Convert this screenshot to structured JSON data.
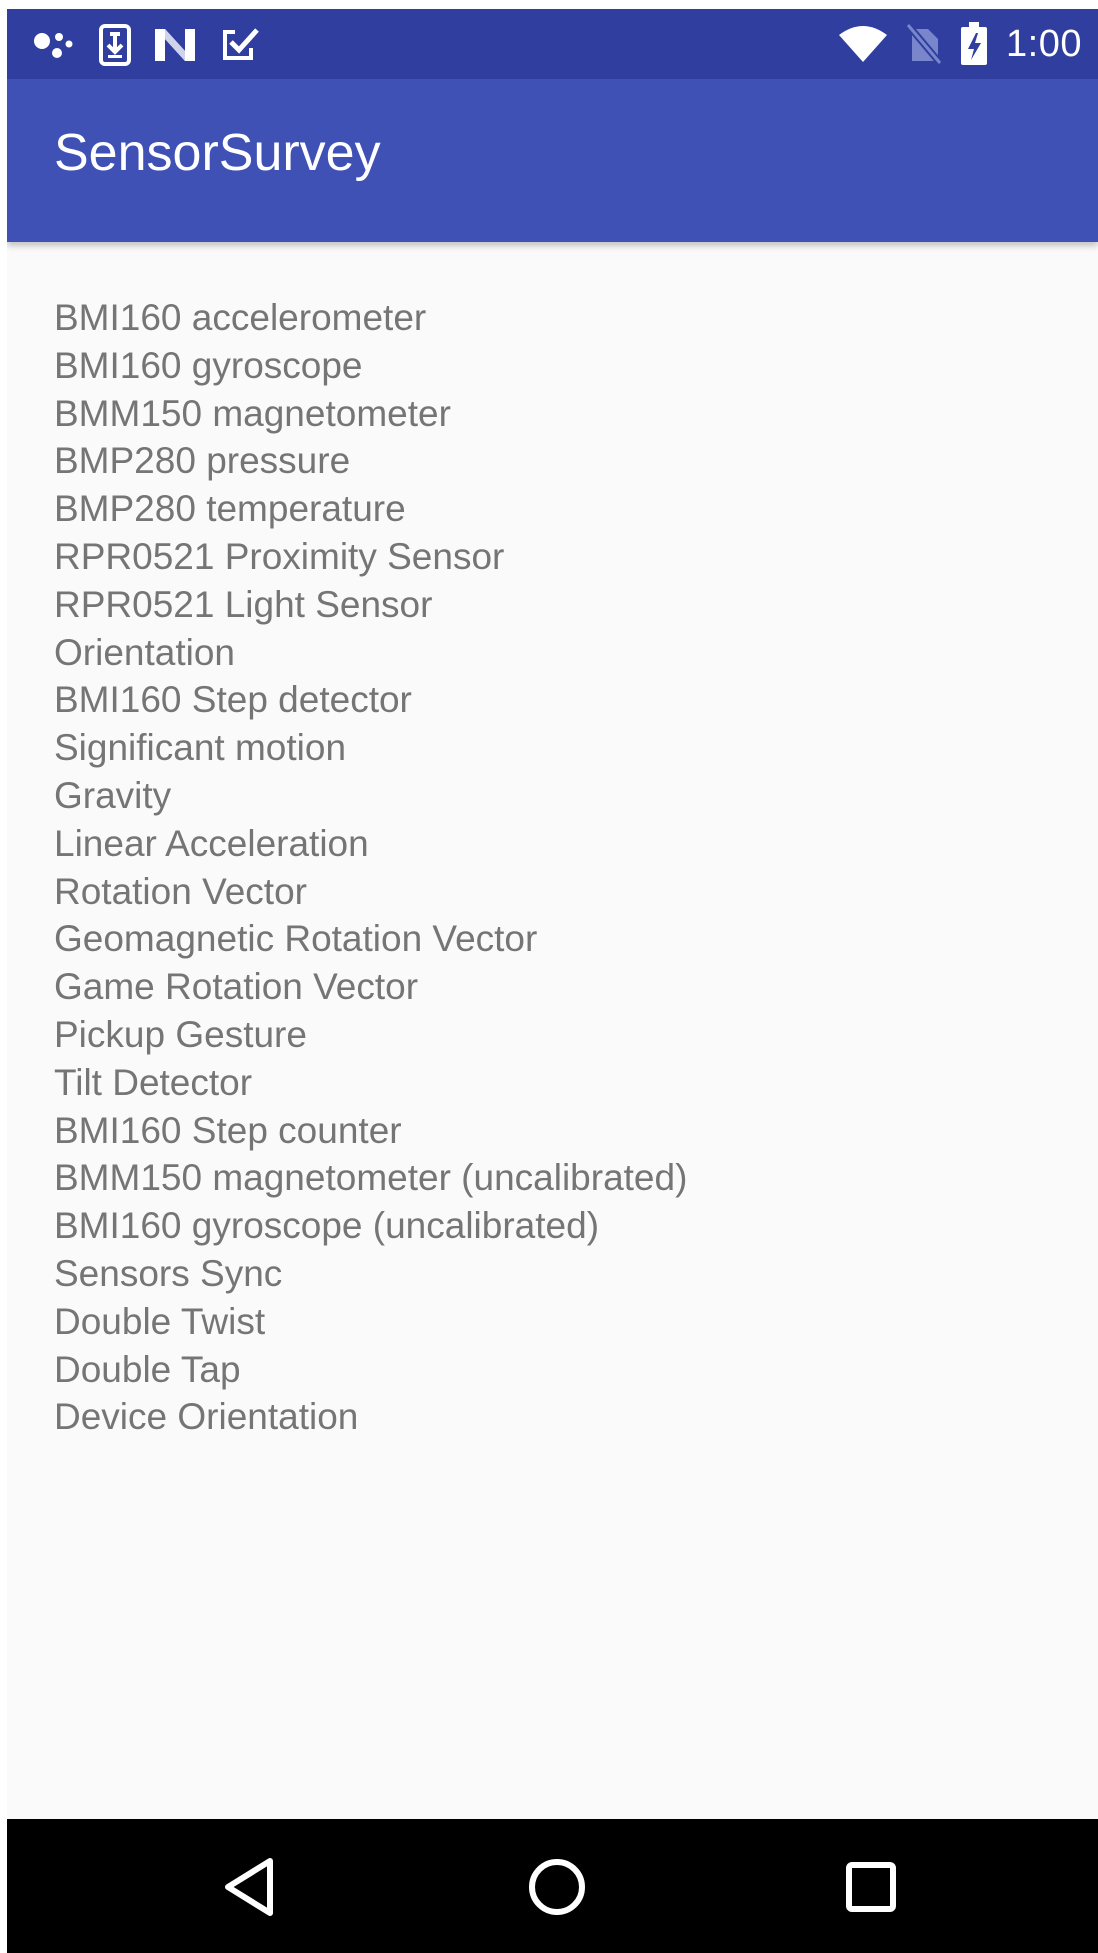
{
  "status_bar": {
    "time": "1:00",
    "left_icons": [
      "assistant-dots-icon",
      "download-icon",
      "n-logo-icon",
      "checkbox-check-icon"
    ],
    "right_icons": [
      "wifi-icon",
      "no-sim-icon",
      "battery-charging-icon"
    ],
    "background": "#303f9f"
  },
  "app_bar": {
    "title": "SensorSurvey",
    "background": "#3f51b5"
  },
  "sensors": [
    "BMI160 accelerometer",
    "BMI160 gyroscope",
    "BMM150 magnetometer",
    "BMP280 pressure",
    "BMP280 temperature",
    "RPR0521 Proximity Sensor",
    "RPR0521 Light Sensor",
    "Orientation",
    "BMI160 Step detector",
    "Significant motion",
    "Gravity",
    "Linear Acceleration",
    "Rotation Vector",
    "Geomagnetic Rotation Vector",
    "Game Rotation Vector",
    "Pickup Gesture",
    "Tilt Detector",
    "BMI160 Step counter",
    "BMM150 magnetometer (uncalibrated)",
    "BMI160 gyroscope (uncalibrated)",
    "Sensors Sync",
    "Double Twist",
    "Double Tap",
    "Device Orientation"
  ],
  "nav_bar": {
    "buttons": [
      "back-icon",
      "home-icon",
      "recents-icon"
    ]
  }
}
